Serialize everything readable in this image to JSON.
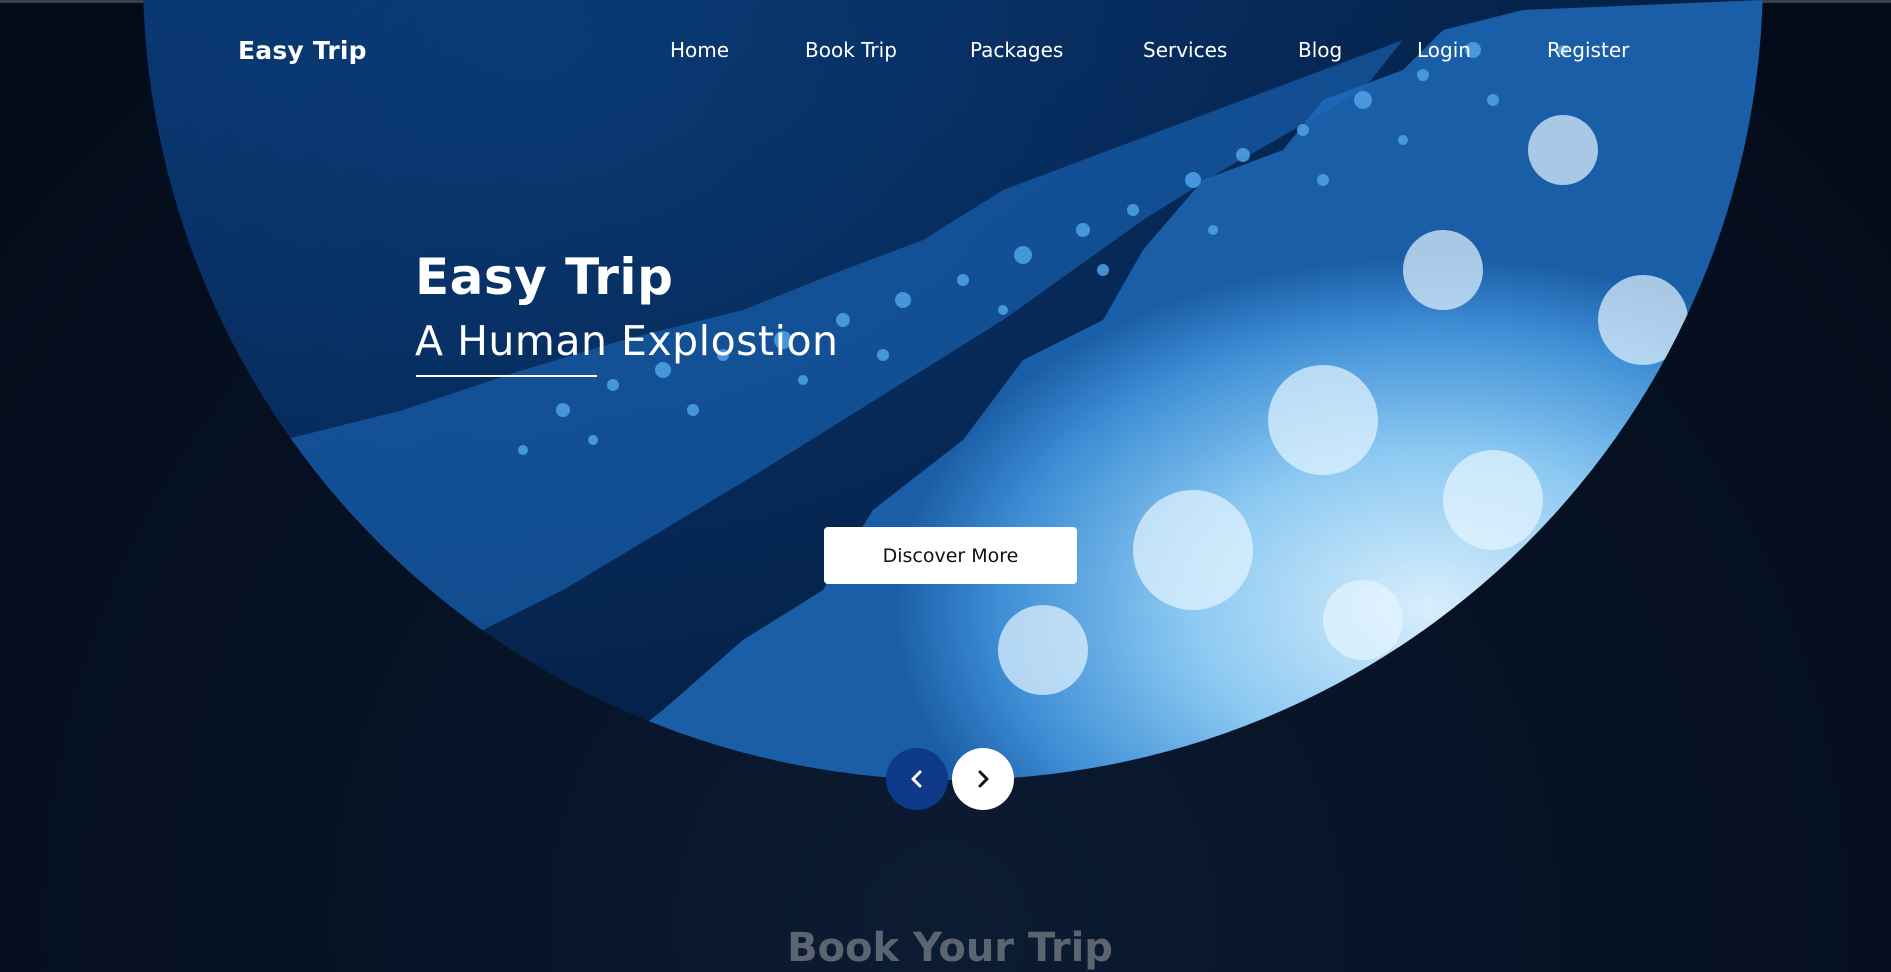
{
  "brand": {
    "logo_text": "Easy Trip"
  },
  "nav": {
    "items": [
      {
        "label": "Home"
      },
      {
        "label": "Book Trip"
      },
      {
        "label": "Packages"
      },
      {
        "label": "Services"
      },
      {
        "label": "Blog"
      },
      {
        "label": "Login"
      },
      {
        "label": "Register"
      }
    ]
  },
  "hero": {
    "title": "Easy Trip",
    "subtitle": "A Human Explostion",
    "cta_label": "Discover More",
    "image": "ocean-wave-foam"
  },
  "slider": {
    "prev_icon": "chevron-left-icon",
    "next_icon": "chevron-right-icon"
  },
  "section": {
    "title": "Book Your Trip"
  },
  "colors": {
    "background": "#040e1e",
    "prev_button": "#0f3a8a",
    "next_button": "#ffffff",
    "text": "#ffffff",
    "section_title": "#5c6470"
  }
}
